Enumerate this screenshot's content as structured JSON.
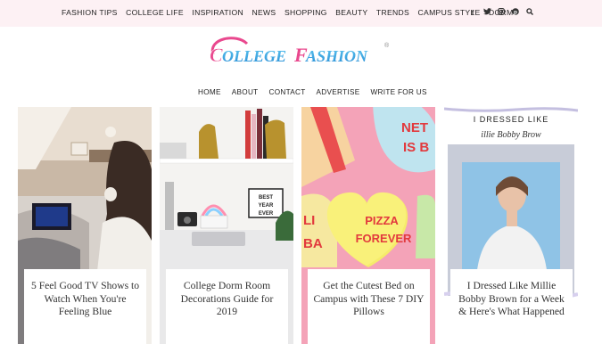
{
  "topnav": [
    "FASHION TIPS",
    "COLLEGE LIFE",
    "INSPIRATION",
    "NEWS",
    "SHOPPING",
    "BEAUTY",
    "TRENDS",
    "CAMPUS STYLE",
    "DORM"
  ],
  "social": [
    "facebook-icon",
    "twitter-icon",
    "instagram-icon",
    "pinterest-icon",
    "search-icon"
  ],
  "logo": {
    "text": "COLLEGE FASHION",
    "mark": "®"
  },
  "subnav": [
    "HOME",
    "ABOUT",
    "CONTACT",
    "ADVERTISE",
    "WRITE FOR US"
  ],
  "cards": [
    {
      "title": "5 Feel Good TV Shows to Watch When You're Feeling Blue"
    },
    {
      "title": "College Dorm Room Decorations Guide for 2019",
      "lightbox": "BEST YEAR EVER"
    },
    {
      "title": "Get the Cutest Bed on Campus with These 7 DIY Pillows",
      "pillow": "PIZZA FOREVER",
      "heart_top": "NETI IS BA",
      "heart_left": "LI BA"
    },
    {
      "title": "I Dressed Like Millie Bobby Brown for a Week & Here's What Happened",
      "banner1": "I DRESSED LIKE",
      "banner2": "illie Bobby Brow"
    }
  ],
  "colors": {
    "topbar": "#fdf1f4",
    "logo_pink": "#e9488e",
    "logo_blue": "#3fb3e6"
  }
}
